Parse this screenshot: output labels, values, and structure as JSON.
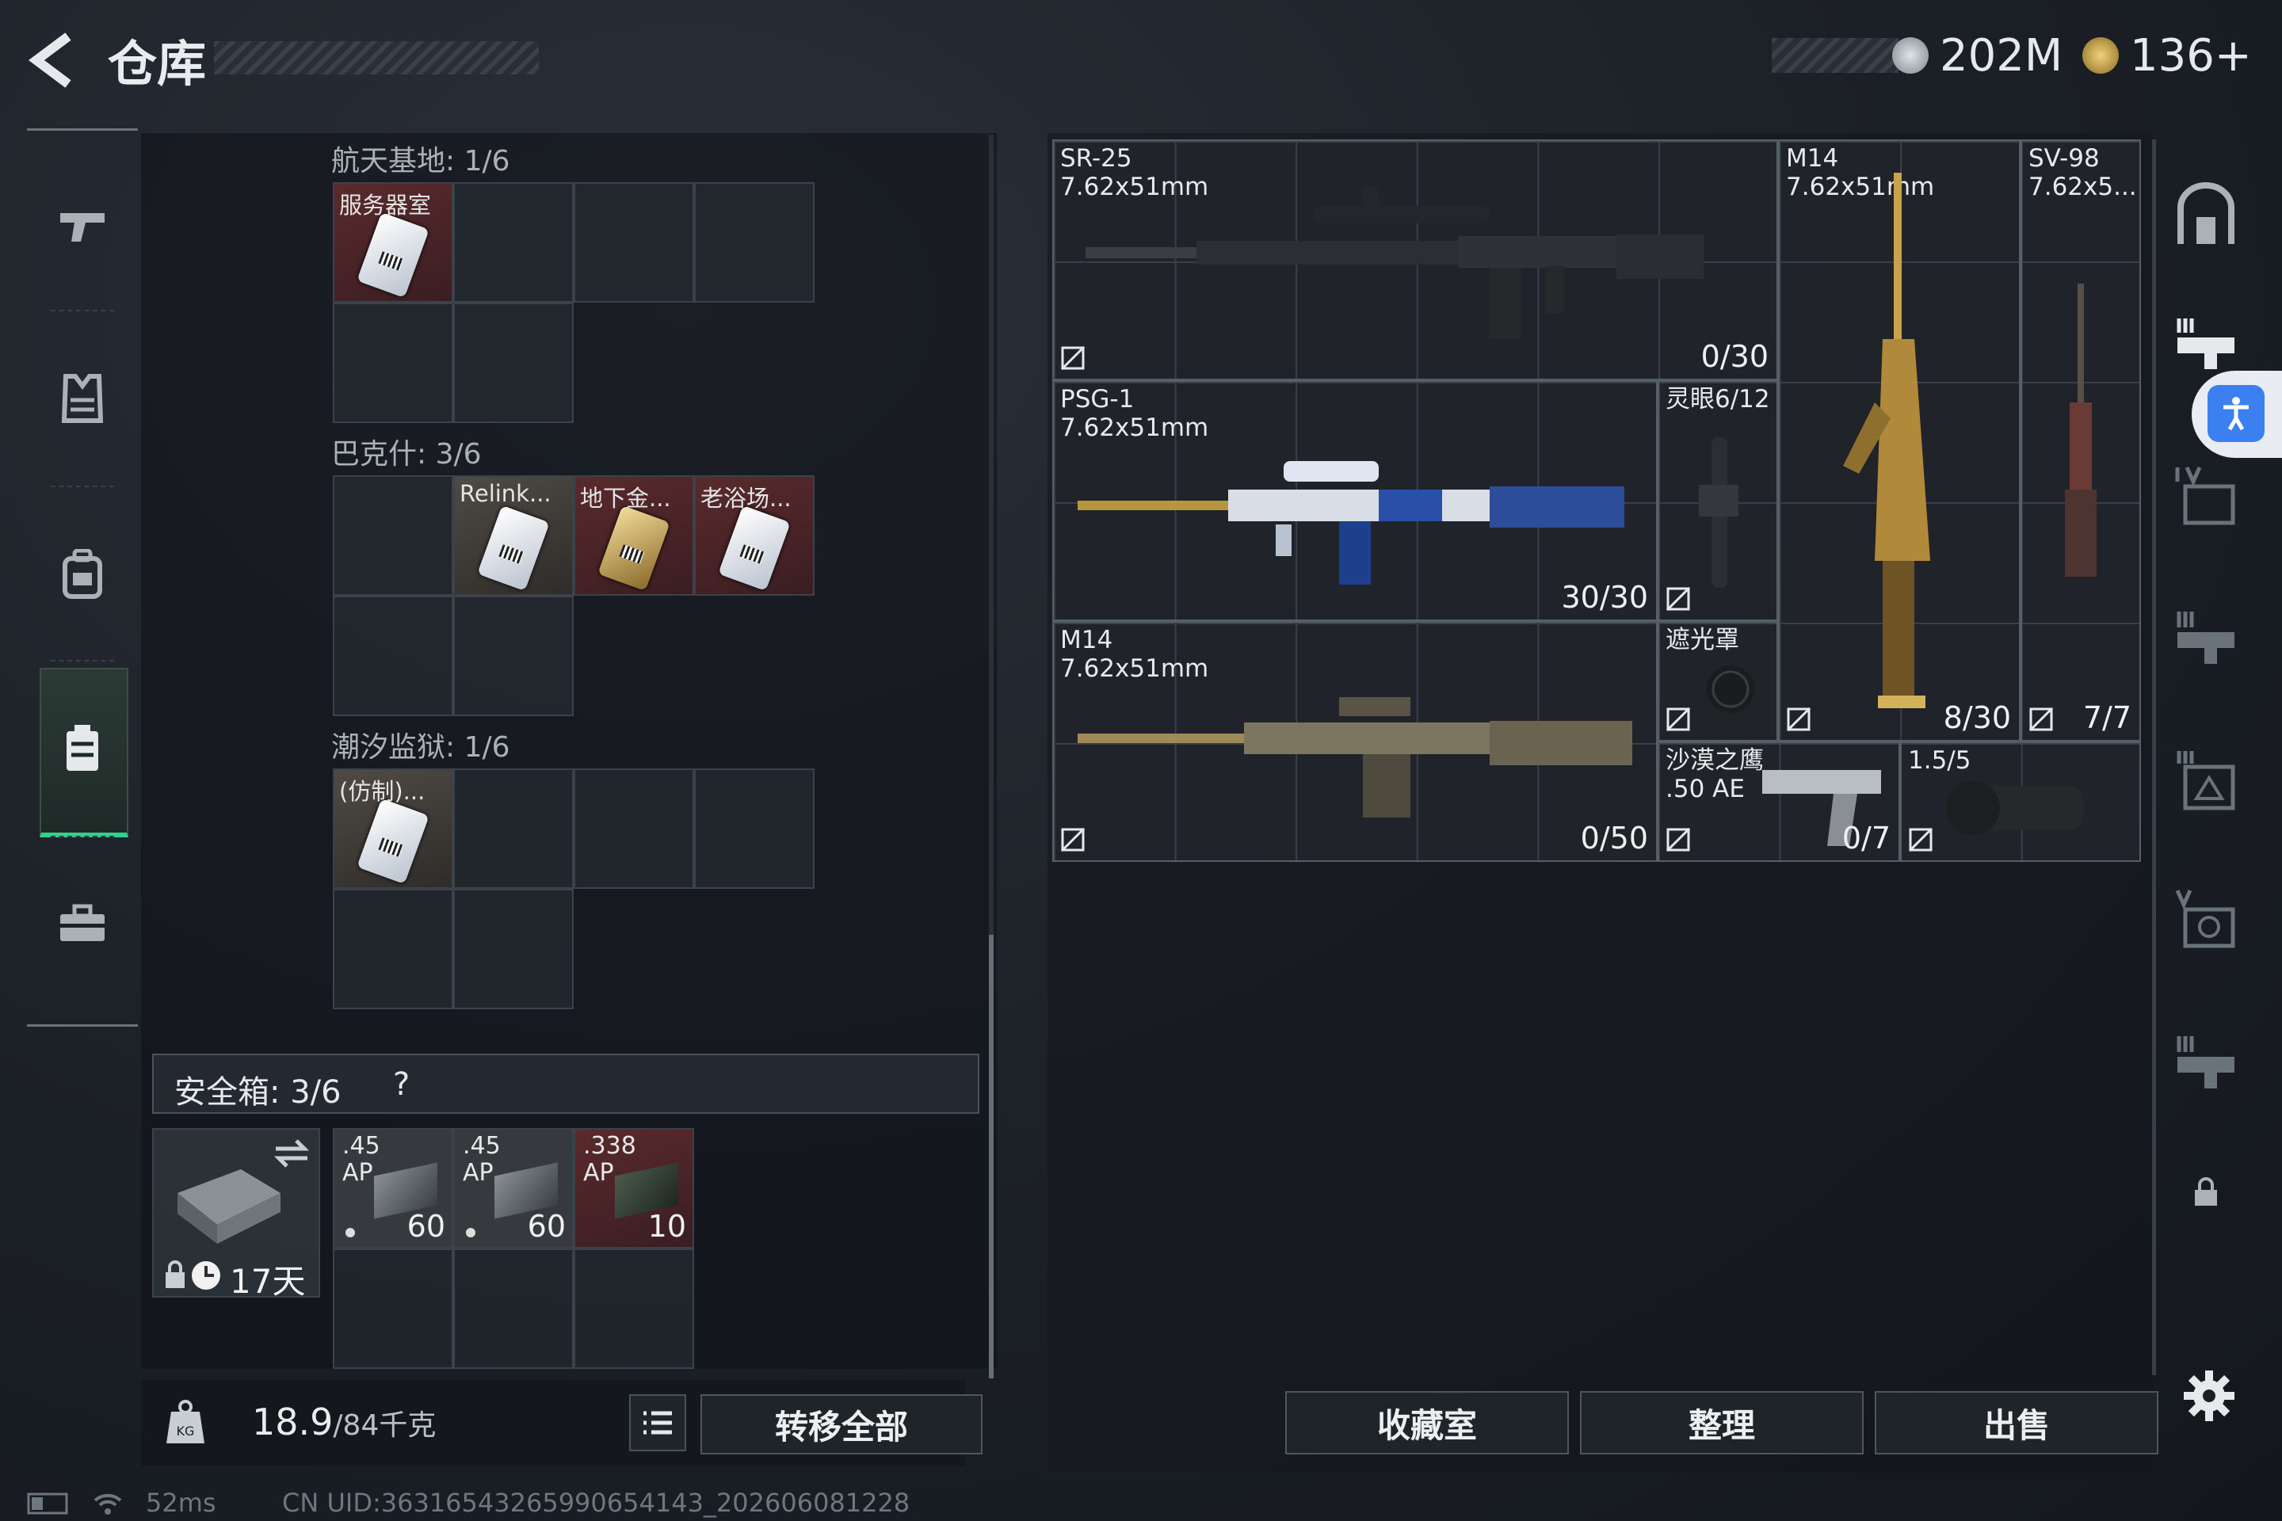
{
  "header": {
    "title": "仓库",
    "currency_coins": "202M",
    "currency_tokens": "136+"
  },
  "nav": {
    "items": [
      "weapons-tab",
      "armor-tab",
      "backpack-tab",
      "container-tab",
      "case-tab"
    ]
  },
  "sections": [
    {
      "title": "航天基地: 1/6",
      "items": [
        "服务器室"
      ]
    },
    {
      "title": "巴克什: 3/6",
      "items": [
        "Relink...",
        "地下金...",
        "老浴场..."
      ]
    },
    {
      "title": "潮汐监狱: 1/6",
      "items": [
        "(仿制)..."
      ]
    }
  ],
  "safebox": {
    "title": "安全箱: 3/6",
    "help": "?",
    "timer": "17天",
    "ammo": [
      {
        "caliber": ".45",
        "type": "AP",
        "count": "60"
      },
      {
        "caliber": ".45",
        "type": "AP",
        "count": "60"
      },
      {
        "caliber": ".338",
        "type": "AP",
        "count": "10"
      }
    ]
  },
  "footer": {
    "weight": "18.9",
    "weight_cap": "/84千克",
    "transfer_all": "转移全部"
  },
  "weapons": [
    {
      "name": "SR-25",
      "caliber": "7.62x51mm",
      "ammo": "0/30"
    },
    {
      "name": "M14",
      "caliber": "7.62x51mm",
      "ammo": "8/30"
    },
    {
      "name": "SV-98",
      "caliber": "7.62x5...",
      "ammo": "7/7"
    },
    {
      "name": "PSG-1",
      "caliber": "7.62x51mm",
      "ammo": "30/30"
    },
    {
      "name": "灵眼6/12",
      "caliber": "",
      "ammo": ""
    },
    {
      "name": "M14",
      "caliber": "7.62x51mm",
      "ammo": "0/50"
    },
    {
      "name": "遮光罩",
      "caliber": "",
      "ammo": ""
    },
    {
      "name": "沙漠之鹰",
      "caliber": ".50 AE",
      "ammo": "0/7"
    },
    {
      "name": "1.5/5",
      "caliber": "",
      "ammo": ""
    }
  ],
  "actions": {
    "collection": "收藏室",
    "organize": "整理",
    "sell": "出售"
  },
  "status": {
    "ping": "52ms",
    "uid": "CN UID:36316543265990654143_202606081228"
  },
  "colors": {
    "accent_green": "#2fd18f",
    "item_red": "#5a2a2c",
    "access_blue": "#3b7ff0"
  }
}
